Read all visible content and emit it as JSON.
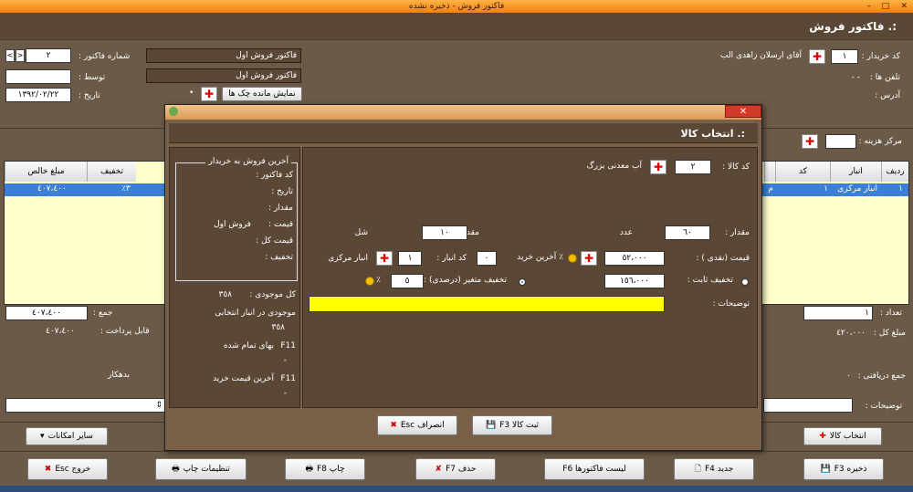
{
  "window": {
    "title": "فاکتور فروش - ذخیره نشده",
    "controls": [
      "–",
      "□",
      "✕"
    ]
  },
  "header": {
    "title": ":. فاکتور فروش"
  },
  "form": {
    "buyer_code_label": "کد خریدار :",
    "buyer_code": "١",
    "buyer_name": "آقای ارسلان  زاهدی الب",
    "phone_label": "تلفن ها :",
    "phone_value": "-   -",
    "address_label": "آدرس :",
    "invoice_no_label": "شماره فاکتور :",
    "invoice_no": "٢",
    "by_label": "توسط :",
    "date_label": "تاریخ :",
    "date_value": "١٣٩٢/٠٢/٢٢",
    "type1": "فاکتور فروش اول",
    "type2": "فاکتور فروش اول",
    "checks_button": "نمایش مانده چک ها",
    "cost_center_label": "مرکز هزینه :",
    "nav_prev": "<",
    "nav_next": ">"
  },
  "grid": {
    "headers": [
      "ردیف",
      "انبار",
      "کد",
      "",
      "تخفیف",
      "مبلغ خالص"
    ],
    "row": {
      "index": "١",
      "warehouse": "انبار مرکزی",
      "wh_code": "١",
      "code_frag": "م",
      "discount": "٣٪",
      "net": "٤٠٧،٤٠٠"
    },
    "count_label": "تعداد :",
    "count_value": "١",
    "sum_label": "جمع :",
    "sum_value": "٤٠٧،٤٠٠"
  },
  "totals": {
    "total_label": "مبلغ کل :",
    "total_value": "٤٢٠،٠٠٠",
    "payable_label": "قابل پرداخت :",
    "payable_value": "٤٠٧،٤٠٠",
    "received_label": "جمع دریافتی :",
    "received_value": "٠",
    "debtor_label": "بدهکار",
    "notes_label": "توضیحات :"
  },
  "bottom_buttons": {
    "select_goods": "انتخاب کالا",
    "other": "سایر امکانات",
    "save": "ذخیره F3",
    "new": "جدید F4",
    "list": "لیست فاکتورها F6",
    "delete": "حذف F7",
    "print": "چاپ F8",
    "print_settings": "تنظیمات چاپ",
    "exit": "خروج Esc"
  },
  "dialog": {
    "title": ":. انتخاب کالا",
    "goods_code_label": "کد کالا :",
    "goods_code": "٢",
    "goods_name": "آب معدنی بزرگ",
    "qty_label": "مقدار :",
    "qty_value": "٦٠",
    "unit1": "عدد",
    "qty2_label": "مقدار ٢ :",
    "qty2_value": "١٠",
    "unit2": "شل",
    "price_label": "قیمت (نقدی ) :",
    "price_value": "٥٢،٠٠٠",
    "last_buy": "٪ آخرین خرید",
    "wh_code_label": "کد انبار :",
    "wh_code_value": "٠",
    "wh_num": "١",
    "wh_name": "انبار مرکزی",
    "fixed_disc_label": "تخفیف ثابت :",
    "fixed_disc_value": "١٥٦،٠٠٠",
    "var_disc_label": "تخفیف متغیر (درصدی) :",
    "var_disc_value": "٥",
    "pct": "٪",
    "notes_label": "توضیحات :",
    "side_title": "آخرین فروش به خریدار",
    "side_invoice_label": "کد فاکتور :",
    "side_date_label": "تاریخ :",
    "side_qty_label": "مقدار :",
    "side_price_label": "قیمت :",
    "side_price_value": "فروش اول",
    "side_total_label": "قیمت کل :",
    "side_discount_label": "تخفیف :",
    "stock_label": "کل موجودی :",
    "stock_value": "٣٥٨",
    "stock_wh_label": "موجودی در انبار انتخابی",
    "stock_wh_value": "٣٥٨",
    "f11_a": "F11",
    "cost_label": "بهای تمام شده",
    "dot1": "-",
    "f11_b": "F11",
    "last_buy_label": "آخرین قیمت خرید",
    "dot2": "-",
    "register_button": "ثبت کالا F3",
    "cancel_button": "انصراف Esc"
  }
}
